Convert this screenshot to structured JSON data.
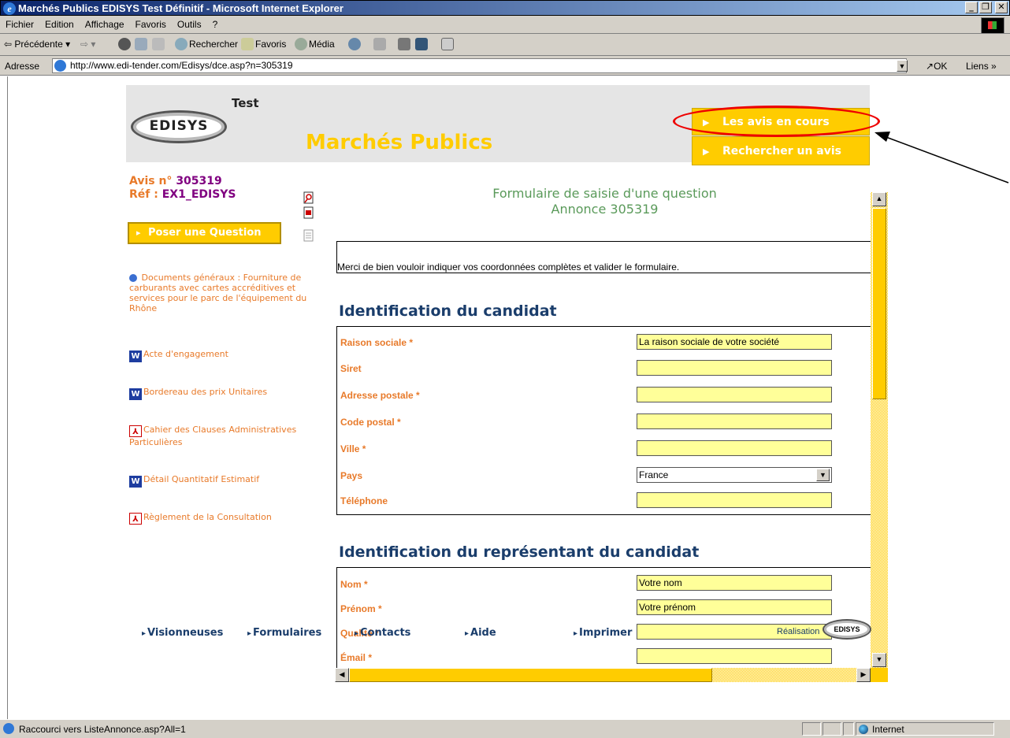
{
  "window": {
    "title": "Marchés Publics EDISYS Test Définitif - Microsoft Internet Explorer"
  },
  "menu": [
    "Fichier",
    "Edition",
    "Affichage",
    "Favoris",
    "Outils",
    "?"
  ],
  "toolbar": {
    "back": "⇦ Précédente ▾",
    "forward": "⇨ ▾",
    "search": "Rechercher",
    "favorites": "Favoris",
    "media": "Média"
  },
  "address": {
    "label": "Adresse",
    "url": "http://www.edi-tender.com/Edisys/dce.asp?n=305319",
    "go": "OK",
    "links": "Liens"
  },
  "header": {
    "logo_text": "EDISYS",
    "logo_sub": "Test",
    "site_title": "Marchés Publics",
    "nav_current": "Les avis en cours",
    "nav_search": "Rechercher un avis"
  },
  "sidebar": {
    "avis_label": "Avis n°",
    "avis_number": "305319",
    "ref_label": "Réf :",
    "ref_value": "EX1_EDISYS",
    "ask_button": "Poser une Question",
    "documents": [
      {
        "icon": "globe-icon",
        "label": "Documents généraux : Fourniture de carburants avec cartes accréditives et services pour le parc de l'équipement du Rhône"
      },
      {
        "icon": "word-icon",
        "label": "Acte d'engagement"
      },
      {
        "icon": "word-icon",
        "label": "Bordereau des prix Unitaires"
      },
      {
        "icon": "pdf-icon",
        "label": "Cahier des Clauses Administratives Particulières"
      },
      {
        "icon": "word-icon",
        "label": "Détail Quantitatif Estimatif"
      },
      {
        "icon": "pdf-icon",
        "label": "Règlement de la Consultation"
      }
    ]
  },
  "form": {
    "title": "Formulaire de saisie d'une question",
    "subtitle": "Annonce 305319",
    "intro": "Merci de bien vouloir indiquer vos coordonnées complètes et valider le formulaire.",
    "section1": "Identification du candidat",
    "section2": "Identification du représentant du candidat",
    "candidate_fields": [
      {
        "label": "Raison sociale *",
        "value": "La raison sociale de votre société"
      },
      {
        "label": "Siret",
        "value": ""
      },
      {
        "label": "Adresse postale *",
        "value": ""
      },
      {
        "label": "Code postal *",
        "value": ""
      },
      {
        "label": "Ville *",
        "value": ""
      },
      {
        "label": "Pays",
        "value": "France"
      },
      {
        "label": "Téléphone",
        "value": ""
      }
    ],
    "rep_fields": [
      {
        "label": "Nom *",
        "value": "Votre nom"
      },
      {
        "label": "Prénom *",
        "value": "Votre prénom"
      },
      {
        "label": "Qualité *",
        "value": ""
      },
      {
        "label": "Émail *",
        "value": ""
      }
    ]
  },
  "footer": {
    "links": [
      "Visionneuses",
      "Formulaires",
      "Contacts",
      "Aide",
      "Imprimer"
    ],
    "realisation": "Réalisation",
    "logo_text": "EDISYS"
  },
  "status": {
    "text": "Raccourci vers ListeAnnonce.asp?All=1",
    "zone": "Internet"
  },
  "colors": {
    "accent": "#ffcc00",
    "orange_text": "#e87a2a",
    "navy_text": "#1a3d6b",
    "purple_text": "#800080",
    "green_title": "#5a9a5a",
    "input_bg": "#ffff99",
    "annotation_red": "#ee0000"
  }
}
